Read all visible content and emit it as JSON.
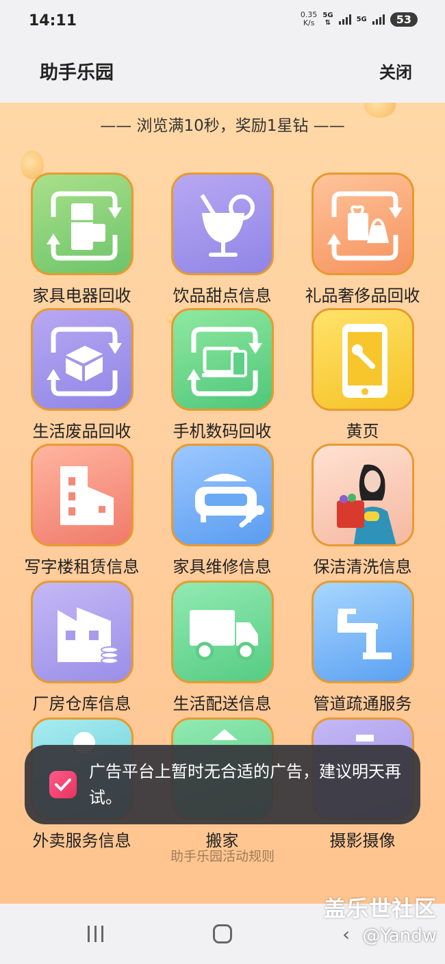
{
  "status_bar": {
    "time": "14:11",
    "net_speed_value": "0.35",
    "net_speed_unit": "K/s",
    "network_1": "5G",
    "network_2": "5G",
    "battery": "53"
  },
  "header": {
    "title": "助手乐园",
    "close_label": "关闭"
  },
  "reward_banner": "—— 浏览满10秒，奖励1星钻 ——",
  "services": [
    {
      "label": "家具电器回收",
      "icon": "appliance-recycle-icon"
    },
    {
      "label": "饮品甜点信息",
      "icon": "cocktail-icon"
    },
    {
      "label": "礼品奢侈品回收",
      "icon": "gift-recycle-icon"
    },
    {
      "label": "生活废品回收",
      "icon": "waste-recycle-icon"
    },
    {
      "label": "手机数码回收",
      "icon": "devices-recycle-icon"
    },
    {
      "label": "黄页",
      "icon": "phone-wrench-icon"
    },
    {
      "label": "写字楼租赁信息",
      "icon": "building-icon"
    },
    {
      "label": "家具维修信息",
      "icon": "sofa-wrench-icon"
    },
    {
      "label": "保洁清洗信息",
      "icon": "cleaner-icon"
    },
    {
      "label": "厂房仓库信息",
      "icon": "factory-icon"
    },
    {
      "label": "生活配送信息",
      "icon": "truck-icon"
    },
    {
      "label": "管道疏通服务",
      "icon": "pipe-icon"
    },
    {
      "label": "外卖服务信息",
      "icon": "delivery-person-icon"
    },
    {
      "label": "搬家",
      "icon": "moving-cart-icon"
    },
    {
      "label": "摄影摄像",
      "icon": "camera-icon"
    }
  ],
  "rules_link": "助手乐园活动规则",
  "toast": {
    "message": "广告平台上暂时无合适的广告，建议明天再试。"
  },
  "watermark": {
    "line1": "盖乐世社区",
    "line2": "@Yandw"
  },
  "colors": {
    "accent_border": "#e89a2e",
    "toast_bg": "#37373c",
    "page_bg": "#ffd0a0"
  }
}
